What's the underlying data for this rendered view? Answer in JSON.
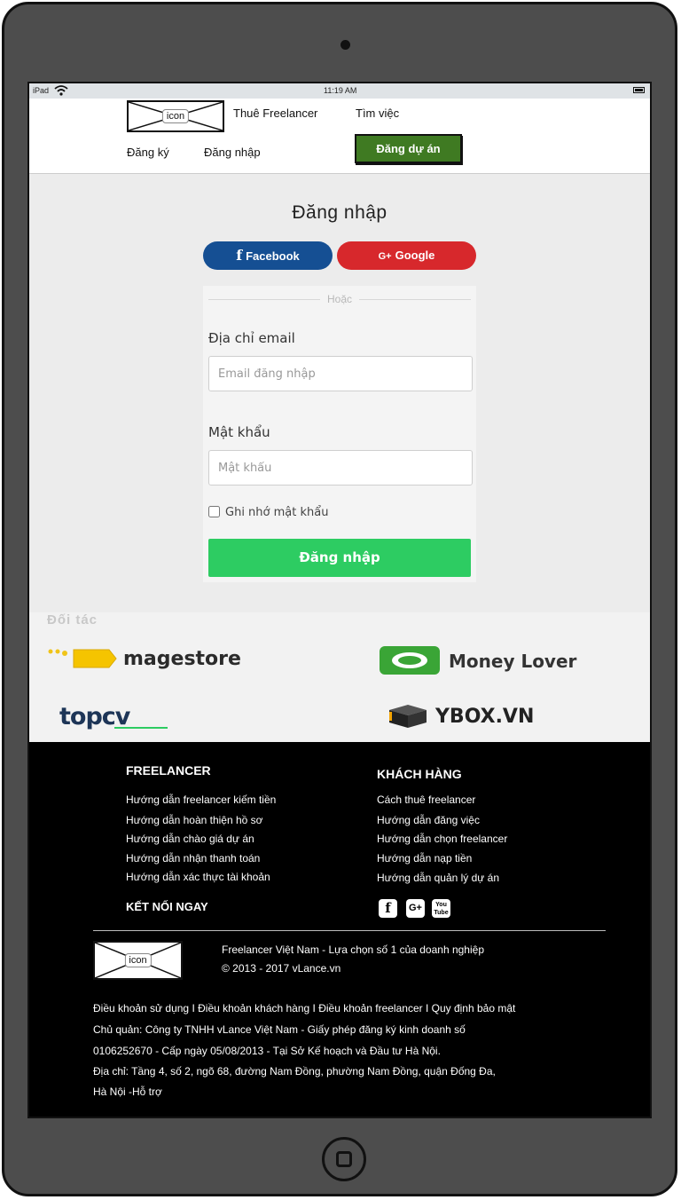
{
  "status": {
    "device": "iPad",
    "time": "11:19 AM"
  },
  "header": {
    "logo_label": "icon",
    "nav": {
      "hire": "Thuê Freelancer",
      "find_job": "Tìm việc",
      "register": "Đăng ký",
      "login": "Đăng nhập"
    },
    "post_project": "Đăng dự án"
  },
  "login": {
    "title": "Đăng nhập",
    "facebook": "Facebook",
    "google": "Google",
    "google_icon_text": "G+",
    "or": "Hoặc",
    "email_label": "Địa chỉ email",
    "email_placeholder": "Email đăng nhập",
    "password_label": "Mật khẩu",
    "password_placeholder": "Mật khẩu",
    "remember": "Ghi nhớ mật khẩu",
    "submit": "Đăng nhập"
  },
  "partners": {
    "title": "Đối tác",
    "items": [
      "magestore",
      "Money Lover",
      "topcv",
      "YBOX.VN"
    ]
  },
  "footer": {
    "col1": {
      "title": "FREELANCER",
      "links": [
        "Hướng dẫn freelancer kiếm tiền",
        "Hướng dẫn hoàn thiện hồ sơ",
        "Hướng dẫn chào giá dự án",
        "Hướng dẫn nhận thanh toán",
        "Hướng dẫn xác thực tài khoản"
      ]
    },
    "col2": {
      "title": "KHÁCH HÀNG",
      "links": [
        "Cách thuê freelancer",
        "Hướng dẫn đăng việc",
        "Hướng dẫn chọn freelancer",
        "Hướng dẫn nạp tiền",
        "Hướng dẫn quản lý dự án"
      ]
    },
    "connect": "KẾT NỐI NGAY",
    "social": [
      "f",
      "G+",
      "You Tube"
    ],
    "logo_label": "icon",
    "tagline": "Freelancer Việt Nam - Lựa chọn số 1 của doanh nghiệp",
    "copyright": "© 2013 - 2017 vLance.vn",
    "legal_links": "Điều khoản sử dụng I Điều khoản khách hàng I Điều khoản freelancer I Quy định bảo mật",
    "owner_1": "Chủ quản: Công ty TNHH vLance Việt Nam - Giấy phép đăng ký kinh doanh số",
    "owner_2": "0106252670 - Cấp ngày 05/08/2013 - Tại Sở Kế hoạch và Đầu tư Hà Nội.",
    "address_1": "Địa chỉ: Tầng 4, số 2, ngõ 68, đường Nam Đồng, phường Nam Đồng, quận Đống Đa,",
    "address_2": "Hà Nội -Hỗ trợ"
  }
}
